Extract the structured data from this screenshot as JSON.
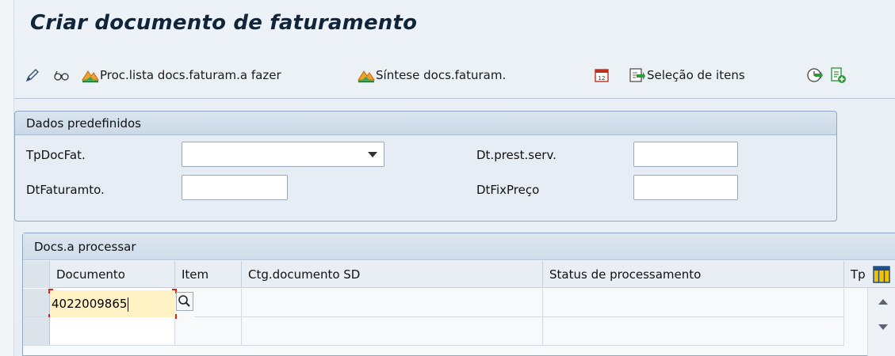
{
  "title": "Criar documento de faturamento",
  "toolbar": {
    "proc_list_label": "Proc.lista docs.faturam.a fazer",
    "synthesis_label": "Síntese docs.faturam.",
    "item_selection_label": "Seleção de itens"
  },
  "predefined": {
    "header": "Dados predefinidos",
    "billing_type_label": "TpDocFat.",
    "billing_type_value": "",
    "service_date_label": "Dt.prest.serv.",
    "service_date_value": "",
    "billing_date_label": "DtFaturamto.",
    "billing_date_value": "",
    "pricing_date_label": "DtFixPreço",
    "pricing_date_value": ""
  },
  "docs_table": {
    "title": "Docs.a processar",
    "columns": [
      "Documento",
      "Item",
      "Ctg.documento SD",
      "Status de processamento",
      "Tp"
    ],
    "rows": [
      {
        "document": "4022009865",
        "item": "",
        "category": "",
        "status": "",
        "tp": ""
      },
      {
        "document": "",
        "item": "",
        "category": "",
        "status": "",
        "tp": ""
      }
    ]
  },
  "icons": [
    "pencil-icon",
    "glasses-icon",
    "mountain-list-icon",
    "mountain-synthesis-icon",
    "calendar-icon",
    "selection-icon",
    "execute-clock-icon",
    "add-document-icon",
    "column-config-icon",
    "value-help-icon"
  ],
  "colors": {
    "title": "#10243a",
    "accent_orange": "#e08a1e",
    "green": "#2e9a3a",
    "focus_red": "#e02020",
    "input_focus_bg": "#fff2c5"
  }
}
